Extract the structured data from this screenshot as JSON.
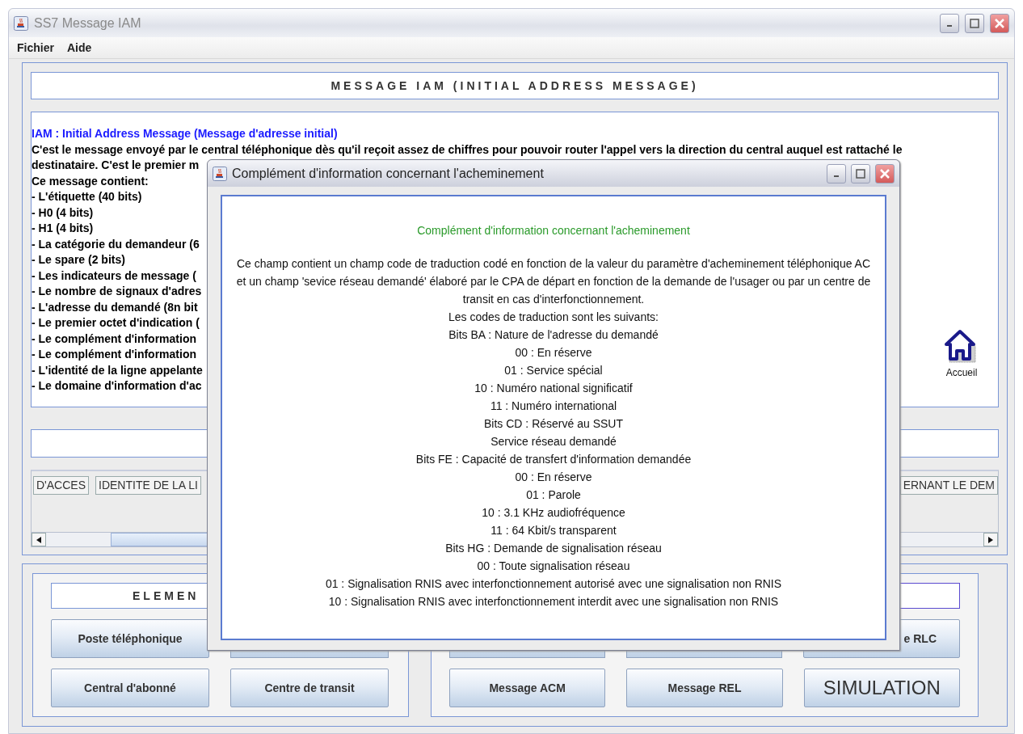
{
  "window": {
    "title": "SS7 Message IAM",
    "menu": [
      "Fichier",
      "Aide"
    ]
  },
  "header": "MESSAGE IAM (INITIAL ADDRESS MESSAGE)",
  "description": {
    "title": "IAM : Initial Address Message (Message d'adresse initial)",
    "intro": "C'est le message envoyé par le central téléphonique dès qu'il reçoit assez de chiffres pour pouvoir router l'appel vers la direction du central auquel est rattaché le",
    "lines": [
      "destinataire. C'est le premier m",
      "Ce message contient:",
      "- L'étiquette (40 bits)",
      "- H0 (4 bits)",
      "- H1 (4 bits)",
      "- La catégorie du demandeur (6",
      "- Le spare (2 bits)",
      "- Les indicateurs de message (",
      "- Le nombre de signaux d'adres",
      "- L'adresse du demandé (8n bit",
      "- Le premier octet d'indication (",
      "- Le complément d'information",
      "- Le complément d'information",
      "- L'identité de la ligne appelante",
      "- Le domaine d'information d'ac"
    ]
  },
  "home": {
    "label": "Accueil"
  },
  "tabs": [
    {
      "label": "D'ACCES"
    },
    {
      "label": "IDENTITE DE LA LI"
    },
    {
      "label": "ERNANT LE DEM"
    }
  ],
  "elements_panel": {
    "title": "ELEMEN",
    "rows": [
      [
        {
          "kind": "button",
          "label": "Poste téléphonique"
        },
        {
          "kind": "covered"
        }
      ],
      [
        {
          "kind": "button",
          "label": "Central d'abonné"
        },
        {
          "kind": "button",
          "label": "Centre de transit"
        }
      ]
    ]
  },
  "messages_panel": {
    "rows": [
      [
        {
          "kind": "covered"
        },
        {
          "kind": "covered"
        },
        {
          "kind": "cut",
          "label": "e RLC"
        }
      ],
      [
        {
          "kind": "button",
          "label": "Message ACM"
        },
        {
          "kind": "button",
          "label": "Message REL"
        },
        {
          "kind": "large",
          "label": "SIMULATION"
        }
      ]
    ]
  },
  "dialog": {
    "title": "Complément d'information concernant l'acheminement",
    "heading": "Complément d'information concernant l'acheminement",
    "paragraph": "Ce champ contient un champ code de traduction codé en fonction de la valeur du paramètre d'acheminement téléphonique AC et un champ 'sevice réseau demandé' élaboré par le CPA de départ en fonction de la demande de l'usager ou par un centre de transit en cas d'interfonctionnement.",
    "lines": [
      "Les codes de traduction sont les suivants:",
      "Bits BA : Nature de l'adresse du demandé",
      "00 : En réserve",
      "01 : Service spécial",
      "10 : Numéro national significatif",
      "11 : Numéro international",
      "Bits CD : Réservé au SSUT",
      "Service réseau demandé",
      "Bits FE : Capacité de transfert d'information demandée",
      "00 : En réserve",
      "01 : Parole",
      "10 : 3.1 KHz audiofréquence",
      "11 : 64 Kbit/s transparent",
      "Bits HG : Demande de signalisation réseau",
      "00 : Toute signalisation réseau",
      "01 : Signalisation RNIS avec interfonctionnement autorisé avec une signalisation non RNIS",
      "10 : Signalisation RNIS avec interfonctionnement interdit avec une signalisation non RNIS"
    ]
  }
}
